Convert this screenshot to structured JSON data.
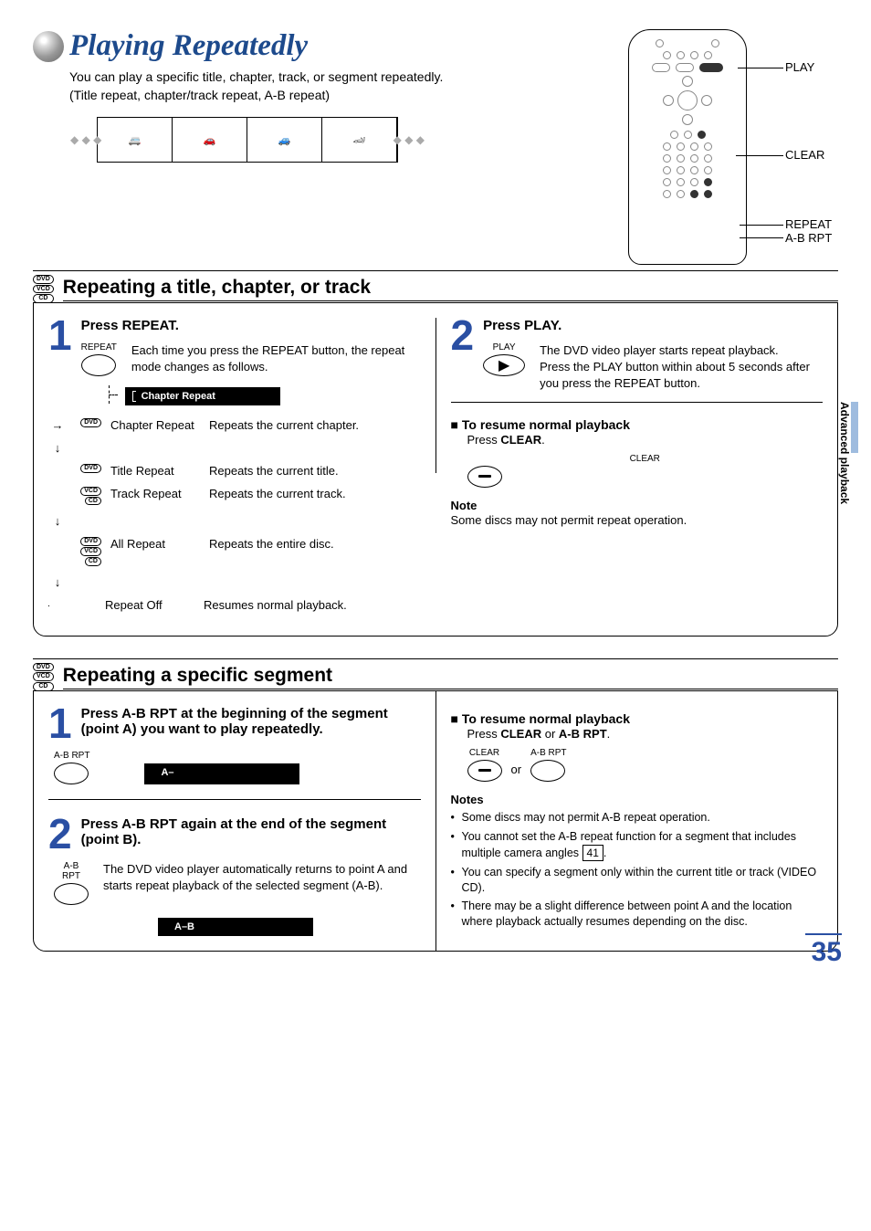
{
  "page": {
    "title": "Playing Repeatedly",
    "intro_line1": "You can play a specific title, chapter, track, or segment repeatedly.",
    "intro_line2": "(Title repeat, chapter/track repeat, A-B repeat)",
    "side_tab": "Advanced playback",
    "number": "35"
  },
  "remote": {
    "labels": {
      "play": "PLAY",
      "clear": "CLEAR",
      "repeat": "REPEAT",
      "abrpt": "A-B RPT"
    }
  },
  "section1": {
    "title": "Repeating a title, chapter, or track",
    "badges": [
      "DVD",
      "VCD",
      "CD"
    ],
    "step1": {
      "num": "1",
      "title": "Press REPEAT.",
      "btn_label": "REPEAT",
      "body": "Each time you press the REPEAT button, the repeat mode changes as follows.",
      "osd": "Chapter Repeat"
    },
    "modes": [
      {
        "badges": [
          "DVD"
        ],
        "name": "Chapter Repeat",
        "desc": "Repeats the current chapter."
      },
      {
        "badges": [
          "DVD"
        ],
        "name": "Title Repeat",
        "desc": "Repeats the current title."
      },
      {
        "badges": [
          "VCD",
          "CD"
        ],
        "name": "Track Repeat",
        "desc": "Repeats the current track."
      },
      {
        "badges": [
          "DVD",
          "VCD",
          "CD"
        ],
        "name": "All Repeat",
        "desc": "Repeats the entire disc."
      },
      {
        "badges": [],
        "name": "Repeat Off",
        "desc": "Resumes normal playback."
      }
    ],
    "step2": {
      "num": "2",
      "title": "Press PLAY.",
      "btn_label": "PLAY",
      "body1": "The DVD video player starts repeat playback.",
      "body2": "Press the PLAY button within about 5 seconds after you press the REPEAT button."
    },
    "resume": {
      "heading": "To resume normal playback",
      "body_prefix": "Press ",
      "body_bold": "CLEAR",
      "body_suffix": ".",
      "btn_label": "CLEAR"
    },
    "note": {
      "label": "Note",
      "text": "Some discs may not permit repeat operation."
    }
  },
  "section2": {
    "title": "Repeating a specific segment",
    "badges": [
      "DVD",
      "VCD",
      "CD"
    ],
    "step1": {
      "num": "1",
      "title": "Press A-B RPT at the beginning of the segment (point A) you want to play repeatedly.",
      "btn_label": "A-B RPT",
      "osd": "A–"
    },
    "step2": {
      "num": "2",
      "title": "Press A-B RPT again at the end of the segment (point B).",
      "btn_label": "A-B RPT",
      "body": "The DVD video player automatically returns to point A and starts repeat playback of the selected segment (A-B).",
      "osd": "A–B"
    },
    "resume": {
      "heading": "To resume normal playback",
      "body_prefix": "Press ",
      "body_bold1": "CLEAR",
      "body_mid": " or ",
      "body_bold2": "A-B RPT",
      "body_suffix": ".",
      "btn1_label": "CLEAR",
      "joiner": "or",
      "btn2_label": "A-B RPT"
    },
    "notes_label": "Notes",
    "notes": [
      "Some discs may not permit A-B repeat operation.",
      "You cannot set the A-B repeat function for a segment that includes multiple camera angles",
      "You can specify a segment only within the current title or track (VIDEO CD).",
      "There may be a slight difference between point A and the location where playback actually resumes depending on the disc."
    ],
    "page_ref": "41"
  }
}
